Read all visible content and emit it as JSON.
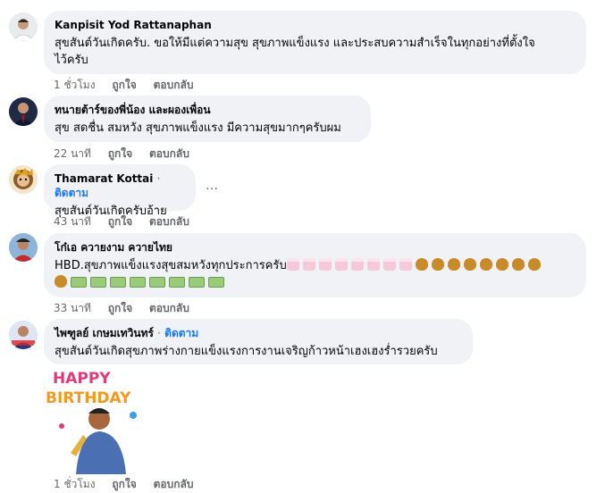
{
  "comments": [
    {
      "author": "Kanpisit Yod Rattanaphan",
      "follow": "",
      "lines": [
        "สุขสันต์วันเกิดครับ. ขอให้มีแต่ความสุข สุขภาพแข็งแรง และประสบความสำเร็จในทุกอย่างที่ตั้งใจ",
        "ไว้ครับ"
      ],
      "time": "1 ชั่วโมง",
      "like": "ถูกใจ",
      "reply": "ตอบกลับ"
    },
    {
      "author": "ทนายต้าร์ของพี่น้อง และผองเพื่อน",
      "follow": "",
      "lines": [
        "สุข สดชื่น สมหวัง สุขภาพแข็งแรง มีความสุขมากๆครับผม"
      ],
      "time": "22 นาที",
      "like": "ถูกใจ",
      "reply": "ตอบกลับ"
    },
    {
      "author": "Thamarat Kottai",
      "follow": "ติดตาม",
      "lines": [
        "สุขสันต์วันเกิดครับอ้าย"
      ],
      "time": "43 นาที",
      "like": "ถูกใจ",
      "reply": "ตอบกลับ"
    },
    {
      "author": "โก๋เอ ควายงาม ควายไทย",
      "follow": "",
      "lines": [
        "HBD.สุขภาพแข็งแรงสุขสมหวังทุกประการครับ"
      ],
      "time": "33 นาที",
      "like": "ถูกใจ",
      "reply": "ตอบกลับ"
    },
    {
      "author": "ไพฑูลย์ เกษมเทวินทร์",
      "follow": "ติดตาม",
      "lines": [
        "สุขสันต์วันเกิดสุขภาพร่างกายแข็งแรงการงานเจริญก้าวหน้าเฮงเฮงร่ำรวยครับ"
      ],
      "time": "1 ชั่วโมง",
      "like": "ถูกใจ",
      "reply": "ตอบกลับ"
    }
  ],
  "separator": "·",
  "more_label": "…",
  "sticker_text": [
    "HAPPY",
    "BIRTHDAY"
  ],
  "icons": {
    "cake": "birthday-cake-icon",
    "money_bag": "money-bag-icon",
    "banknote": "banknote-icon"
  },
  "colors": {
    "accent": "#1877f2",
    "bubble": "#f0f2f5",
    "meta": "#65676b"
  }
}
